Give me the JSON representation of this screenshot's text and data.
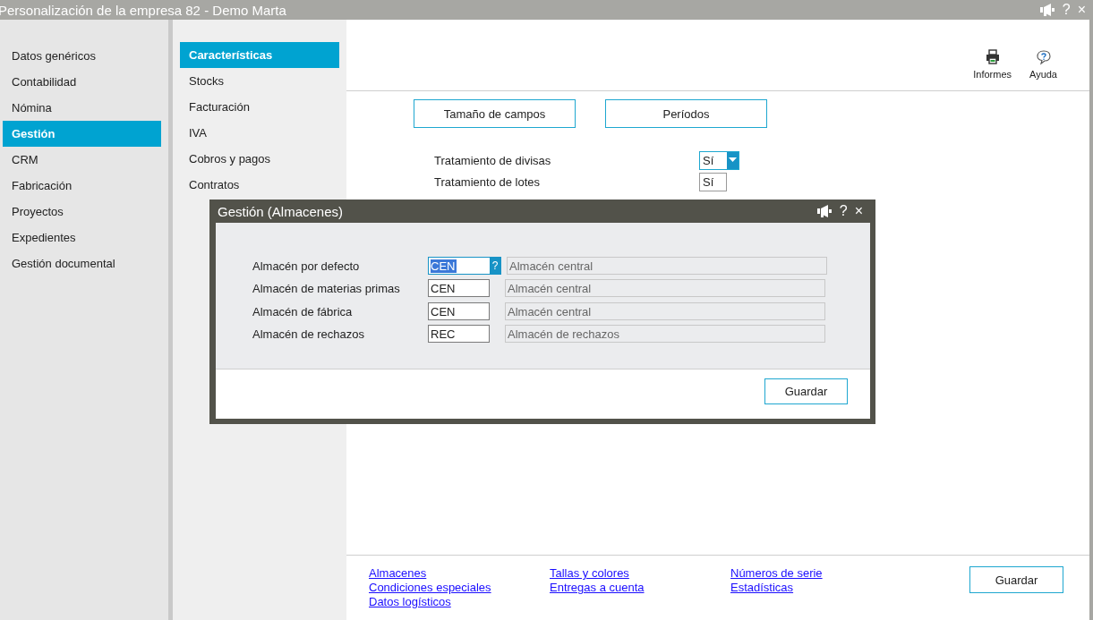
{
  "window": {
    "title": "Personalización de la empresa  82 - Demo Marta",
    "help": "?",
    "close": "×"
  },
  "sidebar": {
    "items": [
      {
        "label": "Datos genéricos",
        "selected": false
      },
      {
        "label": "Contabilidad",
        "selected": false
      },
      {
        "label": "Nómina",
        "selected": false
      },
      {
        "label": "Gestión",
        "selected": true
      },
      {
        "label": "CRM",
        "selected": false
      },
      {
        "label": "Fabricación",
        "selected": false
      },
      {
        "label": "Proyectos",
        "selected": false
      },
      {
        "label": "Expedientes",
        "selected": false
      },
      {
        "label": "Gestión documental",
        "selected": false
      }
    ]
  },
  "subnav": {
    "items": [
      {
        "label": "Características",
        "selected": true
      },
      {
        "label": "Stocks",
        "selected": false
      },
      {
        "label": "Facturación",
        "selected": false
      },
      {
        "label": "IVA",
        "selected": false
      },
      {
        "label": "Cobros y pagos",
        "selected": false
      },
      {
        "label": "Contratos",
        "selected": false
      }
    ]
  },
  "toolbar": [
    {
      "label": "Informes",
      "kind": "print"
    },
    {
      "label": "Ayuda",
      "kind": "help"
    }
  ],
  "buttons": [
    "Tamaño de campos",
    "Períodos"
  ],
  "settings": [
    {
      "label": "Tratamiento de divisas",
      "value": "Sí",
      "kind": "dropdown"
    },
    {
      "label": "Tratamiento de lotes",
      "value": "Sí",
      "kind": "field"
    }
  ],
  "links": [
    [
      "Almacenes",
      "Condiciones especiales",
      "Datos logísticos"
    ],
    [
      "Tallas y colores",
      "Entregas a cuenta"
    ],
    [
      "Números de serie",
      "Estadísticas"
    ]
  ],
  "save_button": "Guardar",
  "dialog": {
    "title": "Gestión (Almacenes)",
    "help": "?",
    "close": "×",
    "fields": [
      {
        "label": "Almacén por defecto",
        "code": "CEN",
        "description": "Almacén central",
        "focused": true,
        "lookup": "?"
      },
      {
        "label": "Almacén de materias primas",
        "code": "CEN",
        "description": "Almacén central",
        "focused": false
      },
      {
        "label": "Almacén de fábrica",
        "code": "CEN",
        "description": "Almacén central",
        "focused": false
      },
      {
        "label": "Almacén de rechazos",
        "code": "REC",
        "description": "Almacén de rechazos",
        "focused": false
      }
    ],
    "save_button": "Guardar"
  }
}
